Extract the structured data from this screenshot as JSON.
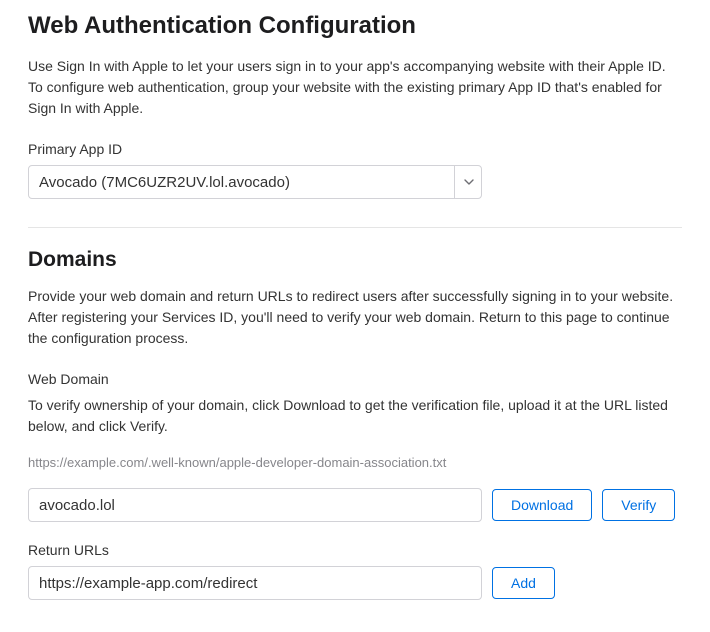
{
  "header": {
    "title": "Web Authentication Configuration",
    "description": "Use Sign In with Apple to let your users sign in to your app's accompanying website with their Apple ID. To configure web authentication, group your website with the existing primary App ID that's enabled for Sign In with Apple."
  },
  "primaryApp": {
    "label": "Primary App ID",
    "selected": "Avocado (7MC6UZR2UV.lol.avocado)"
  },
  "domains": {
    "heading": "Domains",
    "description": "Provide your web domain and return URLs to redirect users after successfully signing in to your website. After registering your Services ID, you'll need to verify your web domain. Return to this page to continue the configuration process.",
    "webDomain": {
      "label": "Web Domain",
      "instructions": "To verify ownership of your domain, click Download to get the verification file, upload it at the URL listed below, and click Verify.",
      "verificationPath": "https://example.com/.well-known/apple-developer-domain-association.txt",
      "value": "avocado.lol",
      "downloadLabel": "Download",
      "verifyLabel": "Verify"
    },
    "returnUrls": {
      "label": "Return URLs",
      "value": "https://example-app.com/redirect",
      "addLabel": "Add"
    }
  }
}
